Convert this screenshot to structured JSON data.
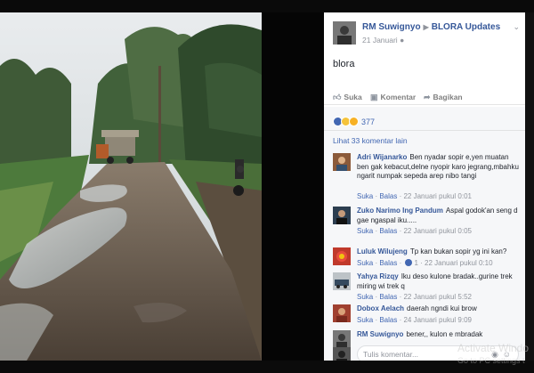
{
  "post": {
    "author": "RM Suwignyo",
    "group": "BLORA Updates",
    "date": "21 Januari",
    "text": "blora"
  },
  "actions": {
    "like": "Suka",
    "comment": "Komentar",
    "share": "Bagikan"
  },
  "reactions": {
    "count": "377"
  },
  "view_more": "Lihat 33 komentar lain",
  "comments": [
    {
      "name": "Adri Wijanarko",
      "text": "Ben nyadar sopir e,yen muatan ben gak kebacut,delne nyopir karo jegrang,mbahku ngarit numpak sepeda arep nibo tangi",
      "like": "Suka",
      "reply": "Balas",
      "time": "22 Januari pukul 0:01"
    },
    {
      "name": "Zuko Narimo Ing Pandum",
      "text": "Aspal godok'an seng d gae ngaspal iku.....",
      "like": "Suka",
      "reply": "Balas",
      "time": "22 Januari pukul 0:05"
    },
    {
      "name": "Luluk Wilujeng",
      "text": "Tp kan bukan sopir yg ini kan?",
      "like": "Suka",
      "reply": "Balas",
      "likes": "1",
      "time": "22 Januari pukul 0:10"
    },
    {
      "name": "Yahya Rizqy",
      "text": "Iku deso kulone bradak..gurine trek miring wi trek q",
      "like": "Suka",
      "reply": "Balas",
      "time": "22 Januari pukul 5:52"
    },
    {
      "name": "Dobox Aelach",
      "text": "daerah ngndi kui brow",
      "like": "Suka",
      "reply": "Balas",
      "time": "24 Januari pukul 9:09"
    },
    {
      "name": "RM Suwignyo",
      "text": "bener,, kulon e mbradak",
      "like": "",
      "reply": "",
      "time": ""
    }
  ],
  "composer": {
    "placeholder": "Tulis komentar..."
  },
  "overlay": {
    "line1": "Activate Windo",
    "line2": "Go to PC settings t"
  },
  "colors": {
    "link": "#365899",
    "accent": "#4267b2",
    "muted": "#90949c"
  }
}
